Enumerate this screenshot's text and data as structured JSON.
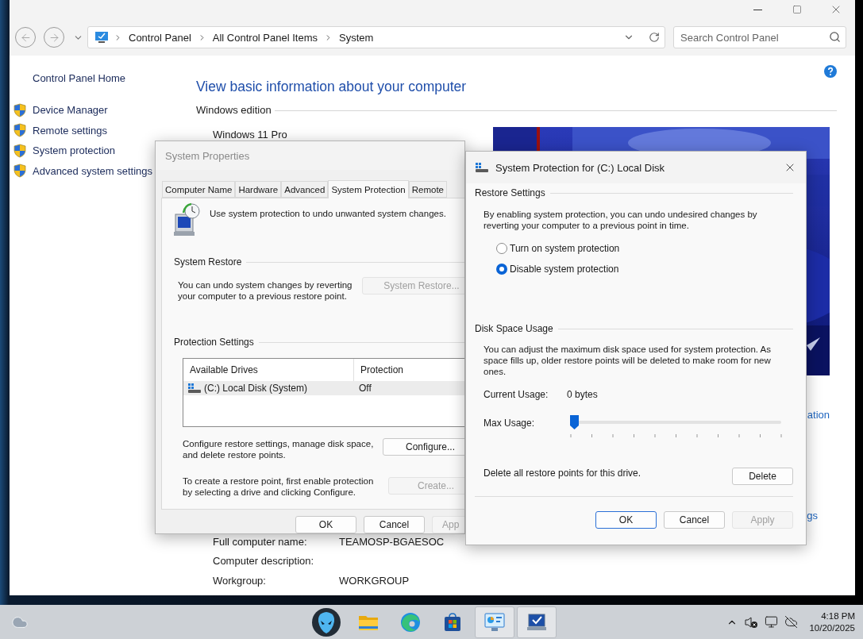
{
  "address_bar": {
    "breadcrumb": [
      "Control Panel",
      "All Control Panel Items",
      "System"
    ]
  },
  "search": {
    "placeholder": "Search Control Panel"
  },
  "sidebar": {
    "home": "Control Panel Home",
    "items": [
      {
        "label": "Device Manager"
      },
      {
        "label": "Remote settings"
      },
      {
        "label": "System protection"
      },
      {
        "label": "Advanced system settings"
      }
    ]
  },
  "main": {
    "heading": "View basic information about your computer",
    "section": "Windows edition",
    "edition": "Windows 11 Pro",
    "banner": {
      "kind": "picture"
    },
    "link_fragments": [
      "ation",
      "gs"
    ],
    "details": [
      {
        "label": "Full computer name:",
        "value": "TEAMOSP-BGAESOC"
      },
      {
        "label": "Computer description:"
      },
      {
        "label": "Workgroup:",
        "value": "WORKGROUP"
      }
    ]
  },
  "system_properties": {
    "title": "System Properties",
    "active": false,
    "tabs": [
      {
        "label": "Computer Name",
        "selected": false
      },
      {
        "label": "Hardware",
        "selected": false
      },
      {
        "label": "Advanced",
        "selected": false
      },
      {
        "label": "System Protection",
        "selected": true
      },
      {
        "label": "Remote",
        "selected": false
      }
    ],
    "intro": "Use system protection to undo unwanted system changes.",
    "restore": {
      "heading": "System Restore",
      "text": "You can undo system changes by reverting your computer to a previous restore point.",
      "button": {
        "label": "System Restore...",
        "disabled": true
      }
    },
    "protection": {
      "heading": "Protection Settings",
      "columns": [
        "Available Drives",
        "Protection"
      ],
      "rows": [
        {
          "drive": "(C:) Local Disk (System)",
          "protection": "Off",
          "selected": true
        }
      ],
      "configure_text": "Configure restore settings, manage disk space, and delete restore points.",
      "configure_button": {
        "label": "Configure...",
        "disabled": false
      },
      "create_text": "To create a restore point, first enable protection by selecting a drive and clicking Configure.",
      "create_button": {
        "label": "Create...",
        "disabled": true
      }
    },
    "buttons": [
      {
        "label": "OK",
        "disabled": false
      },
      {
        "label": "Cancel",
        "disabled": false
      },
      {
        "label": "App",
        "disabled": true
      }
    ]
  },
  "protection_dialog": {
    "title": "System Protection for (C:) Local Disk",
    "active": true,
    "restore_heading": "Restore Settings",
    "restore_text": "By enabling system protection, you can undo undesired changes by reverting your computer to a previous point in time.",
    "options": [
      {
        "label": "Turn on system protection",
        "selected": false
      },
      {
        "label": "Disable system protection",
        "selected": true
      }
    ],
    "disk_heading": "Disk Space Usage",
    "disk_text": "You can adjust the maximum disk space used for system protection. As space fills up, older restore points will be deleted to make room for new ones.",
    "current_usage": {
      "label": "Current Usage:",
      "value": "0 bytes"
    },
    "max_usage": {
      "label": "Max Usage:",
      "level": 0
    },
    "delete_text": "Delete all restore points for this drive.",
    "delete_button": {
      "label": "Delete",
      "disabled": false
    },
    "buttons": [
      {
        "label": "OK",
        "default": true,
        "disabled": false
      },
      {
        "label": "Cancel",
        "default": false,
        "disabled": false
      },
      {
        "label": "Apply",
        "default": false,
        "disabled": true
      }
    ]
  },
  "taskbar": {
    "apps": [
      {
        "kind": "alien",
        "active": false
      },
      {
        "kind": "folder",
        "active": false
      },
      {
        "kind": "browser",
        "active": false
      },
      {
        "kind": "store",
        "active": false
      },
      {
        "kind": "control-panel",
        "active": true
      },
      {
        "kind": "system",
        "active": true
      }
    ],
    "time": "4:18 PM",
    "date": "10/20/2025"
  }
}
